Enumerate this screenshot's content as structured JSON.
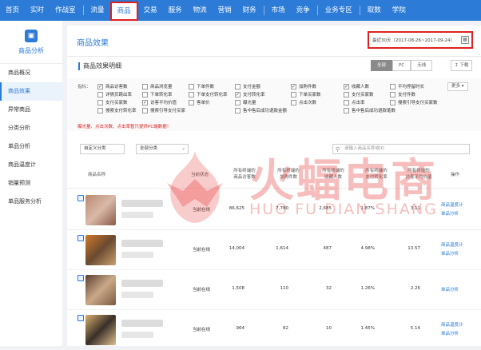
{
  "topnav": {
    "items": [
      "首页",
      "实时",
      "作战室",
      "流量",
      "商品",
      "交易",
      "服务",
      "物流",
      "营销",
      "财务",
      "市场",
      "竞争",
      "业务专区",
      "取数",
      "学院"
    ],
    "active": "商品",
    "accent": "#2c7bd6"
  },
  "sidebar": {
    "title": "商品分析",
    "icon": "shopping-bag-icon",
    "items": [
      "商品概况",
      "商品效果",
      "异常商品",
      "分类分析",
      "单品分析",
      "商品温度计",
      "销量预测",
      "单品服务分析"
    ],
    "active": "商品效果"
  },
  "main": {
    "title": "商品效果",
    "date_range": "最近30天（2017-08-26~2017-09-24）",
    "section_title": "商品效果明细",
    "tabs": [
      "全部",
      "PC",
      "无线"
    ],
    "active_tab": "全部",
    "download_label": "下载",
    "more_label": "更多",
    "filters_label": "指标：",
    "warning": "曝光量、点击次数、点击率暂只提供PC端数据！",
    "checkboxes": [
      {
        "label": "商品访客数",
        "checked": true
      },
      {
        "label": "商品浏览量",
        "checked": false
      },
      {
        "label": "下单件数",
        "checked": false
      },
      {
        "label": "支付金额",
        "checked": false
      },
      {
        "label": "加购件数",
        "checked": true
      },
      {
        "label": "收藏人数",
        "checked": true
      },
      {
        "label": "平均停留时长",
        "checked": false
      },
      {
        "label": "详情页跳出率",
        "checked": false
      },
      {
        "label": "下单转化率",
        "checked": false
      },
      {
        "label": "下单支付转化率",
        "checked": false
      },
      {
        "label": "支付转化率",
        "checked": true
      },
      {
        "label": "下单买家数",
        "checked": false
      },
      {
        "label": "支付买家数",
        "checked": false
      },
      {
        "label": "支付件数",
        "checked": false
      },
      {
        "label": "支付买家数",
        "checked": false
      },
      {
        "label": "访客平均价值",
        "checked": true
      },
      {
        "label": "客单价",
        "checked": false
      },
      {
        "label": "曝光量",
        "checked": false
      },
      {
        "label": "点击次数",
        "checked": false
      },
      {
        "label": "点击率",
        "checked": false
      },
      {
        "label": "搜索引导支付买家数",
        "checked": false
      },
      {
        "label": "搜索支付转化率",
        "checked": false
      },
      {
        "label": "搜索引导支付买家",
        "checked": false
      },
      {
        "label": "售中售后成功退款金额",
        "checked": false
      },
      {
        "label": "售中售后成功退款笔数",
        "checked": false
      }
    ],
    "select_1": "自定义分类",
    "select_2": "全部分类",
    "search_placeholder": "请输入商品名称或ID",
    "table": {
      "headers": {
        "name": "商品名称",
        "status": "当前状态",
        "c1": [
          "所有终端的",
          "商品访客数"
        ],
        "c2": [
          "所有终端的",
          "加购件数"
        ],
        "c3": [
          "所有终端的",
          "收藏人数"
        ],
        "c4": [
          "所有终端的",
          "支付转化率"
        ],
        "c5": [
          "所有终端的",
          "访客平均价值"
        ],
        "action": "操作"
      },
      "rows": [
        {
          "status": "当前在线",
          "c1": "86,625",
          "c2": "7,780",
          "c3": "2,685",
          "c4": "1.87%",
          "c5": "3.11",
          "actions": [
            "商品温度计",
            "单品分析"
          ]
        },
        {
          "status": "当前在线",
          "c1": "14,004",
          "c2": "1,614",
          "c3": "487",
          "c4": "4.98%",
          "c5": "13.57",
          "actions": [
            "商品温度计",
            "单品分析"
          ]
        },
        {
          "status": "当前在线",
          "c1": "1,508",
          "c2": "110",
          "c3": "32",
          "c4": "1.26%",
          "c5": "2.26",
          "actions": [
            "单品分析"
          ]
        },
        {
          "status": "当前在线",
          "c1": "964",
          "c2": "82",
          "c3": "10",
          "c4": "1.45%",
          "c5": "5.14",
          "actions": [
            "商品温度计",
            "单品分析"
          ]
        }
      ]
    }
  },
  "watermark": {
    "main": "火蝠电商",
    "sub": "HUO FU DIAN SHANG",
    "color": "#e63232"
  }
}
